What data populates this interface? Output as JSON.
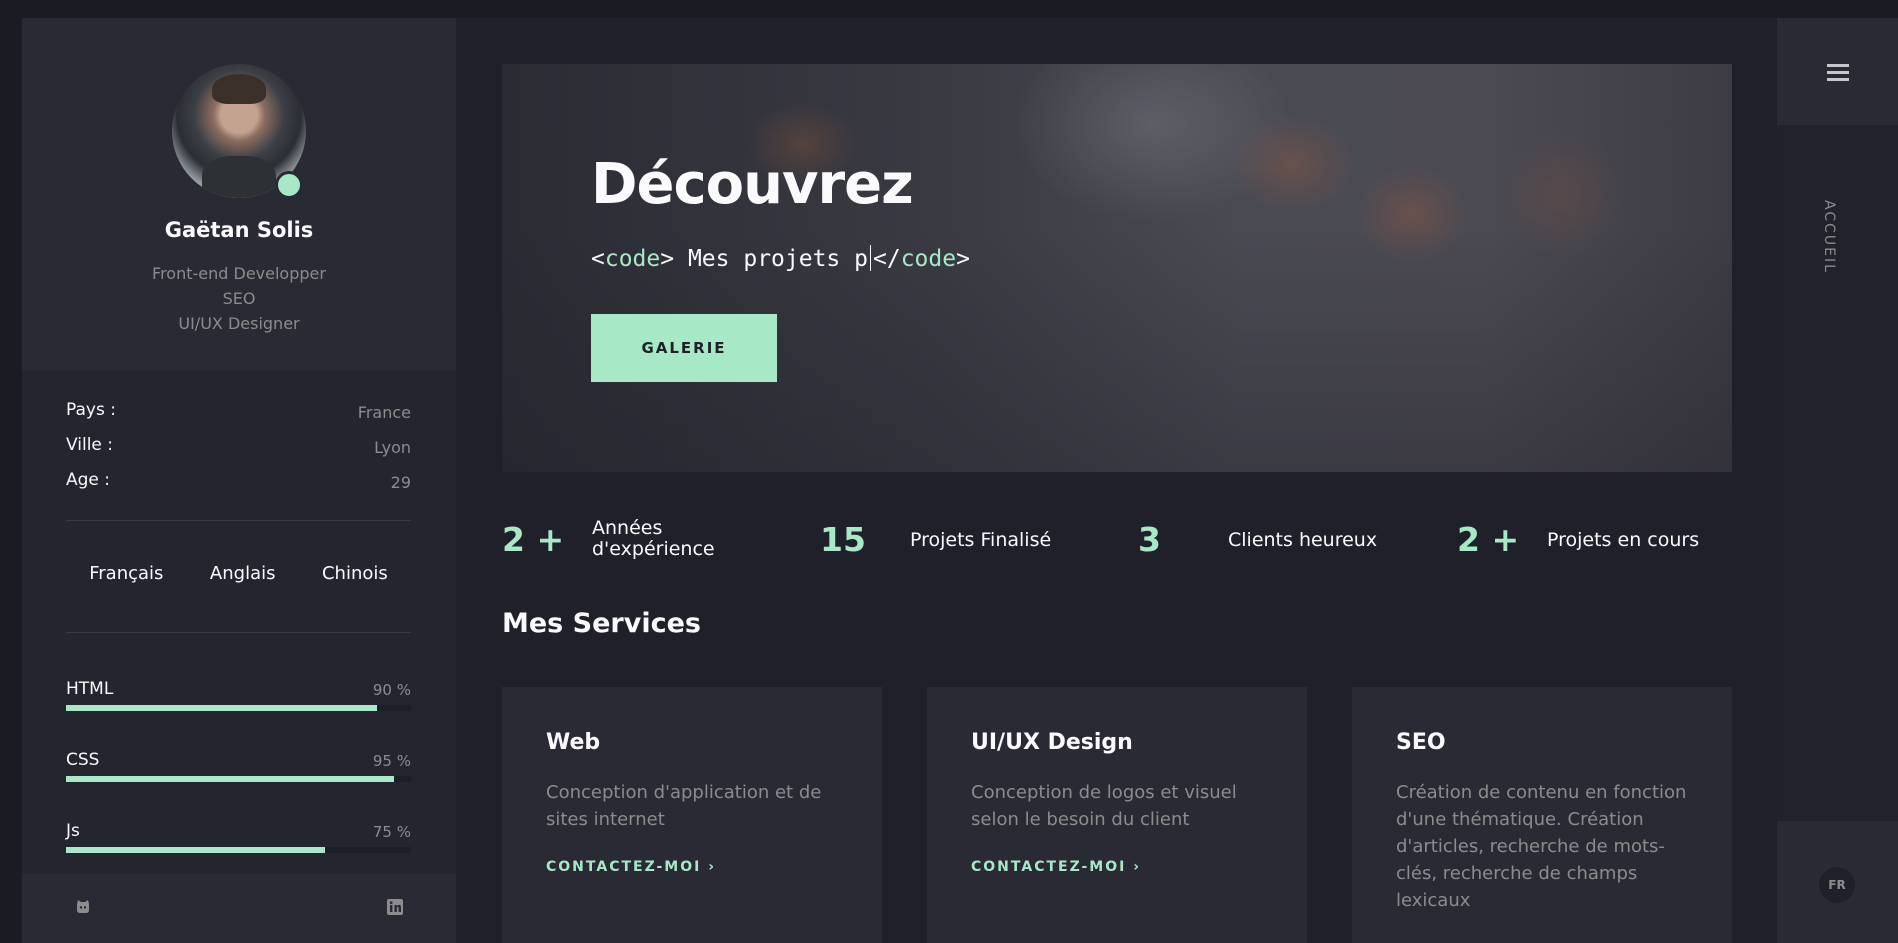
{
  "profile": {
    "name": "Gaëtan Solis",
    "roles": [
      "Front-end Developper",
      "SEO",
      "UI/UX Designer"
    ],
    "status": "online"
  },
  "info": [
    {
      "key": "Pays :",
      "value": "France"
    },
    {
      "key": "Ville :",
      "value": "Lyon"
    },
    {
      "key": "Age :",
      "value": "29"
    }
  ],
  "languages": [
    "Français",
    "Anglais",
    "Chinois"
  ],
  "skills": [
    {
      "name": "HTML",
      "percent_label": "90 %",
      "level": 0.9
    },
    {
      "name": "CSS",
      "percent_label": "95 %",
      "level": 0.95
    },
    {
      "name": "Js",
      "percent_label": "75 %",
      "level": 0.75
    }
  ],
  "sidebar_footer": {
    "icons": [
      "github-icon",
      "linkedin-icon"
    ]
  },
  "hero": {
    "title": "Découvrez",
    "code_open_lt": "<",
    "code_open_tag": "code",
    "code_open_gt": ">",
    "code_text": " Mes projets p",
    "code_close_lt": "</",
    "code_close_tag": "code",
    "code_close_gt": ">",
    "button_label": "GALERIE"
  },
  "stats": [
    {
      "value": "2 +",
      "label_line1": "Années",
      "label_line2": "d'expérience"
    },
    {
      "value": "15",
      "label_line1": "Projets Finalisé",
      "label_line2": ""
    },
    {
      "value": "3",
      "label_line1": "Clients heureux",
      "label_line2": ""
    },
    {
      "value": "2 +",
      "label_line1": "Projets en cours",
      "label_line2": ""
    }
  ],
  "services": {
    "title": "Mes Services",
    "cards": [
      {
        "title": "Web",
        "description": "Conception d'application et de sites internet",
        "link": "CONTACTEZ-MOI ›"
      },
      {
        "title": "UI/UX Design",
        "description": "Conception de logos et visuel selon le besoin du client",
        "link": "CONTACTEZ-MOI ›"
      },
      {
        "title": "SEO",
        "description": "Création de contenu en fonction d'une thématique. Création d'articles, recherche de mots-clés, recherche de champs lexicaux",
        "link": ""
      }
    ]
  },
  "rail": {
    "menu_icon": "hamburger-icon",
    "current_section": "ACCUEIL",
    "language_badge": "FR"
  },
  "colors": {
    "accent": "#a7e8c6",
    "background": "#20202a",
    "panel": "#2a2a34",
    "muted_text": "#8c8c8e"
  }
}
